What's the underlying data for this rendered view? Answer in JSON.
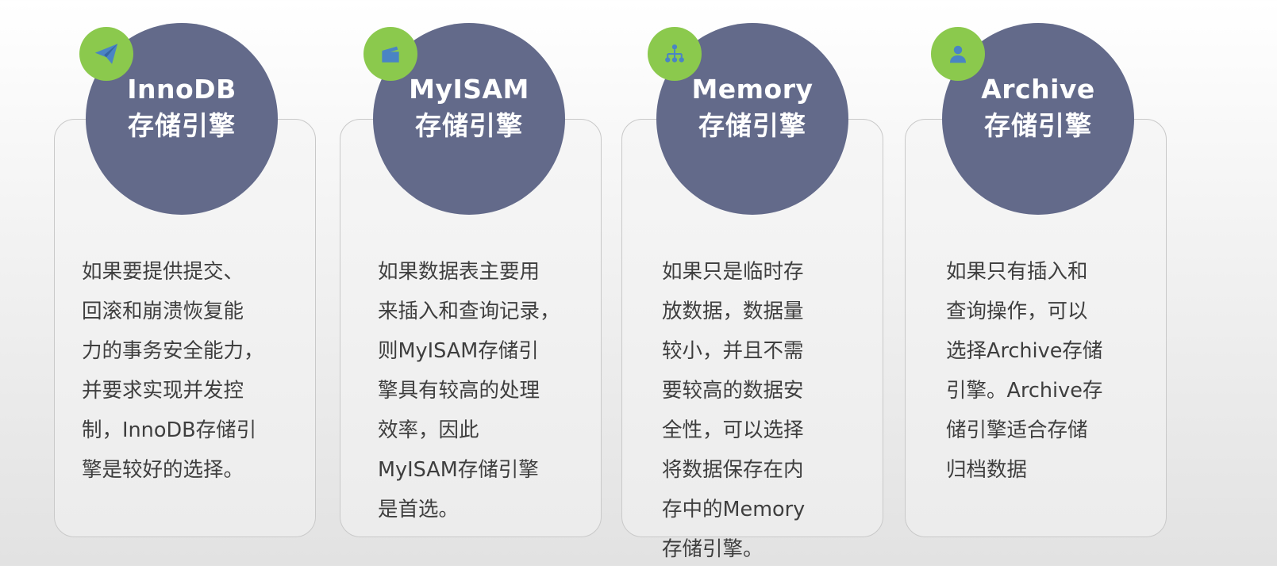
{
  "engines": [
    {
      "name": "InnoDB",
      "subtitle": "存储引擎",
      "icon": "paper-plane-icon",
      "lines": [
        "如果要提供提交、",
        "回滚和崩溃恢复能",
        "力的事务安全能力，",
        "并要求实现并发控",
        "制，InnoDB存储引",
        "擎是较好的选择。"
      ]
    },
    {
      "name": "MyISAM",
      "subtitle": "存储引擎",
      "icon": "card-icon",
      "lines": [
        "如果数据表主要用",
        "来插入和查询记录，",
        "则MyISAM存储引",
        "擎具有较高的处理",
        "效率，因此",
        "MyISAM存储引擎",
        "是首选。"
      ]
    },
    {
      "name": "Memory",
      "subtitle": "存储引擎",
      "icon": "sitemap-icon",
      "lines": [
        "如果只是临时存",
        "放数据，数据量",
        "较小，并且不需",
        "要较高的数据安",
        "全性，可以选择",
        "将数据保存在内",
        "存中的Memory",
        "存储引擎。"
      ]
    },
    {
      "name": "Archive",
      "subtitle": "存储引擎",
      "icon": "user-icon",
      "lines": [
        "如果只有插入和",
        "查询操作，可以",
        "选择Archive存储",
        "引擎。Archive存",
        "储引擎适合存储",
        "归档数据"
      ]
    }
  ],
  "colors": {
    "circle": "#636a8a",
    "badge": "#8bc94d",
    "icon": "#4a84c4",
    "text": "#3e3e3e"
  }
}
